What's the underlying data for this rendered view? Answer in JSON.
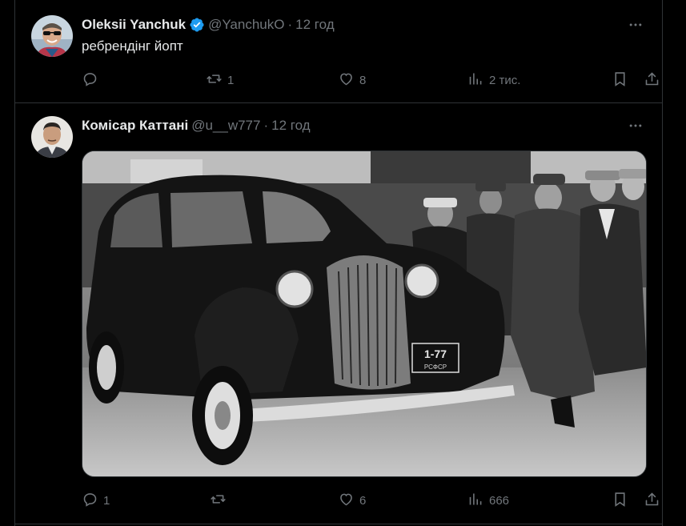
{
  "tweets": [
    {
      "author": {
        "name": "Oleksii Yanchuk",
        "handle": "@YanchukO",
        "verified": true
      },
      "separator": "·",
      "time": "12 год",
      "text": "ребрендінг йопт",
      "stats": {
        "replies": "",
        "retweets": "1",
        "likes": "8",
        "views": "2 тис."
      }
    },
    {
      "author": {
        "name": "Комісар Каттані",
        "handle": "@u__w777",
        "verified": false
      },
      "separator": "·",
      "time": "12 год",
      "text": "",
      "media": {
        "plate_line1": "1-77",
        "plate_line2": "РСФСР"
      },
      "stats": {
        "replies": "1",
        "retweets": "",
        "likes": "6",
        "views": "666"
      }
    }
  ],
  "colors": {
    "background": "#000000",
    "text_primary": "#e7e9ea",
    "text_secondary": "#71767b",
    "border": "#2f3336",
    "verified_badge": "#1d9bf0"
  },
  "icons": [
    "reply-icon",
    "retweet-icon",
    "like-icon",
    "views-icon",
    "bookmark-icon",
    "share-icon",
    "more-icon",
    "verified-icon"
  ]
}
